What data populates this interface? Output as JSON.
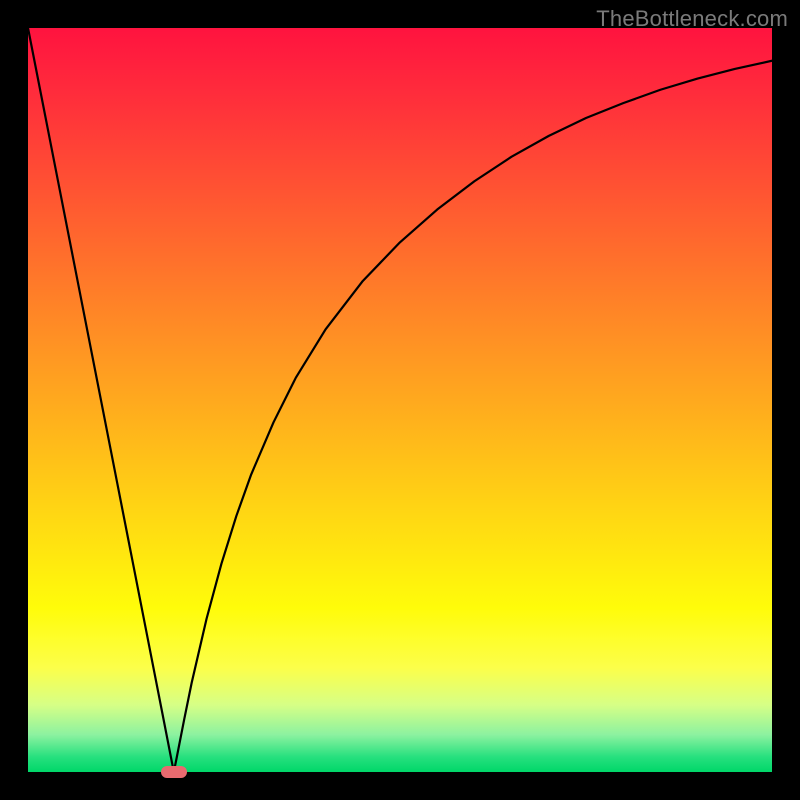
{
  "watermark": "TheBottleneck.com",
  "chart_data": {
    "type": "line",
    "title": "",
    "xlabel": "",
    "ylabel": "",
    "xlim": [
      0,
      100
    ],
    "ylim": [
      0,
      100
    ],
    "series": [
      {
        "name": "curve",
        "x": [
          0,
          2,
          4,
          6,
          8,
          10,
          12,
          14,
          16,
          18,
          19.6,
          20,
          21,
          22,
          24,
          26,
          28,
          30,
          33,
          36,
          40,
          45,
          50,
          55,
          60,
          65,
          70,
          75,
          80,
          85,
          90,
          95,
          100
        ],
        "y": [
          100,
          89.8,
          79.6,
          69.4,
          59.2,
          49.0,
          38.8,
          28.6,
          18.4,
          8.2,
          0,
          2.0,
          7.1,
          12.0,
          20.6,
          28.0,
          34.4,
          40.0,
          47.0,
          53.0,
          59.5,
          66.0,
          71.2,
          75.6,
          79.4,
          82.7,
          85.5,
          87.9,
          89.9,
          91.7,
          93.2,
          94.5,
          95.6
        ]
      }
    ],
    "marker": {
      "x": 19.6,
      "y": 0,
      "color": "#e86a6f"
    },
    "gradient_stops": [
      {
        "pos": 0,
        "color": "#ff133f"
      },
      {
        "pos": 8,
        "color": "#ff2a3c"
      },
      {
        "pos": 22,
        "color": "#ff5432"
      },
      {
        "pos": 36,
        "color": "#ff7f28"
      },
      {
        "pos": 50,
        "color": "#ffa91e"
      },
      {
        "pos": 64,
        "color": "#ffd314"
      },
      {
        "pos": 78,
        "color": "#fffc0a"
      },
      {
        "pos": 86,
        "color": "#fcff4a"
      },
      {
        "pos": 91,
        "color": "#d6ff86"
      },
      {
        "pos": 95,
        "color": "#8cf2a0"
      },
      {
        "pos": 98,
        "color": "#26e07e"
      },
      {
        "pos": 100,
        "color": "#00d769"
      }
    ]
  }
}
